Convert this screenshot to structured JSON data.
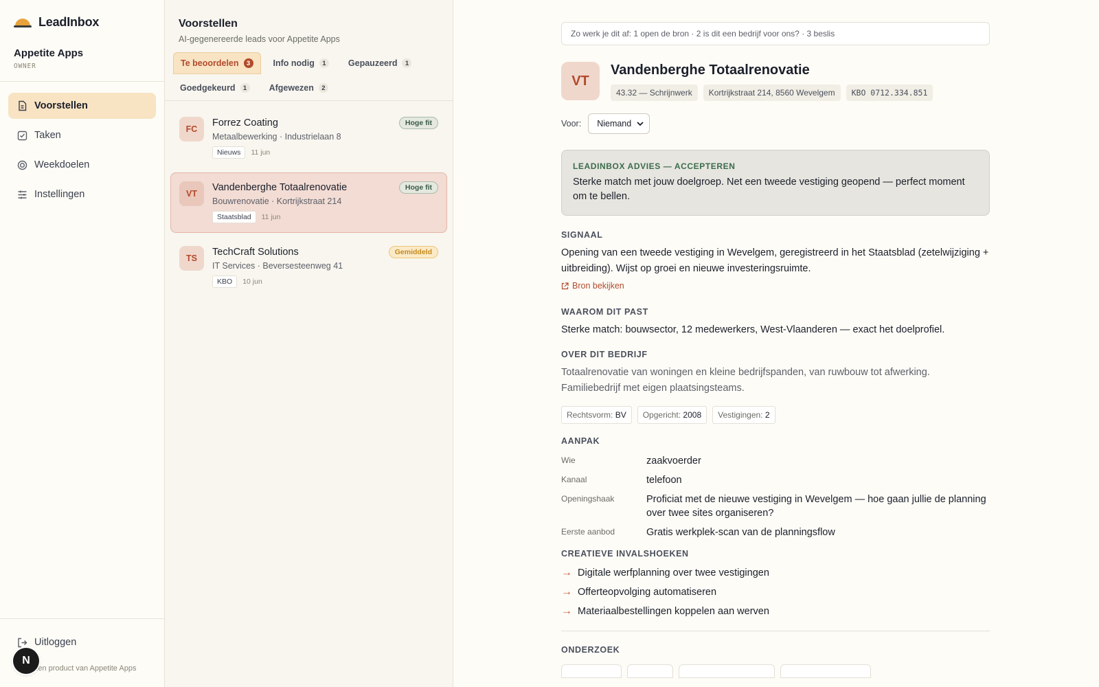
{
  "brand": {
    "name": "LeadInbox",
    "accent": "#e7a23b"
  },
  "org": {
    "name": "Appetite Apps",
    "role": "OWNER"
  },
  "nav": [
    {
      "label": "Voorstellen",
      "icon": "document-icon",
      "active": true
    },
    {
      "label": "Taken",
      "icon": "checkbox-icon",
      "active": false
    },
    {
      "label": "Weekdoelen",
      "icon": "target-icon",
      "active": false
    },
    {
      "label": "Instellingen",
      "icon": "sliders-icon",
      "active": false
    }
  ],
  "logout": "Uitloggen",
  "footer": "Een product van Appetite Apps",
  "n_badge": "N",
  "list": {
    "title": "Voorstellen",
    "subtitle": "AI-gegenereerde leads voor Appetite Apps",
    "tabs": [
      {
        "label": "Te beoordelen",
        "count": "3",
        "active": true
      },
      {
        "label": "Info nodig",
        "count": "1"
      },
      {
        "label": "Gepauzeerd",
        "count": "1"
      },
      {
        "label": "Goedgekeurd",
        "count": "1"
      },
      {
        "label": "Afgewezen",
        "count": "2"
      }
    ],
    "cards": [
      {
        "initials": "FC",
        "name": "Forrez Coating",
        "meta": "Metaalbewerking · Industrielaan 8",
        "source": "Nieuws",
        "date": "11 jun",
        "fit": "Hoge fit",
        "fit_level": "high"
      },
      {
        "initials": "VT",
        "name": "Vandenberghe Totaalrenovatie",
        "meta": "Bouwrenovatie · Kortrijkstraat 214",
        "source": "Staatsblad",
        "date": "11 jun",
        "fit": "Hoge fit",
        "fit_level": "high"
      },
      {
        "initials": "TS",
        "name": "TechCraft Solutions",
        "meta": "IT Services · Beversesteenweg 41",
        "source": "KBO",
        "date": "10 jun",
        "fit": "Gemiddeld",
        "fit_level": "mid"
      }
    ]
  },
  "detail": {
    "howto": "Zo werk je dit af: 1 open de bron · 2 is dit een bedrijf voor ons? · 3 beslis",
    "initials": "VT",
    "name": "Vandenberghe Totaalrenovatie",
    "chips": [
      "43.32 — Schrijnwerk",
      "Kortrijkstraat 214, 8560 Wevelgem",
      "KBO 0712.334.851"
    ],
    "voor_label": "Voor:",
    "voor_value": "Niemand",
    "advice": {
      "label": "LEADINBOX ADVIES — ACCEPTEREN",
      "text": "Sterke match met jouw doelgroep. Net een tweede vestiging geopend — perfect moment om te bellen."
    },
    "signal": {
      "label": "SIGNAAL",
      "text": "Opening van een tweede vestiging in Wevelgem, geregistreerd in het Staatsblad (zetelwijziging + uitbreiding). Wijst op groei en nieuwe investeringsruimte.",
      "link": "Bron bekijken"
    },
    "why": {
      "label": "WAAROM DIT PAST",
      "text": "Sterke match: bouwsector, 12 medewerkers, West-Vlaanderen — exact het doelprofiel."
    },
    "about": {
      "label": "OVER DIT BEDRIJF",
      "text": "Totaalrenovatie van woningen en kleine bedrijfspanden, van ruwbouw tot afwerking. Familiebedrijf met eigen plaatsingsteams.",
      "facts": [
        {
          "key": "Rechtsvorm:",
          "value": "BV"
        },
        {
          "key": "Opgericht:",
          "value": "2008"
        },
        {
          "key": "Vestigingen:",
          "value": "2"
        }
      ]
    },
    "approach": {
      "label": "AANPAK",
      "rows": [
        {
          "key": "Wie",
          "value": "zaakvoerder"
        },
        {
          "key": "Kanaal",
          "value": "telefoon"
        },
        {
          "key": "Openingshaak",
          "value": "Proficiat met de nieuwe vestiging in Wevelgem — hoe gaan jullie de planning over twee sites organiseren?"
        },
        {
          "key": "Eerste aanbod",
          "value": "Gratis werkplek-scan van de planningsflow"
        }
      ]
    },
    "ideas": {
      "label": "CREATIEVE INVALSHOEKEN",
      "items": [
        "Digitale werfplanning over twee vestigingen",
        "Offerteopvolging automatiseren",
        "Materiaalbestellingen koppelen aan werven"
      ]
    },
    "research": {
      "label": "ONDERZOEK"
    }
  }
}
